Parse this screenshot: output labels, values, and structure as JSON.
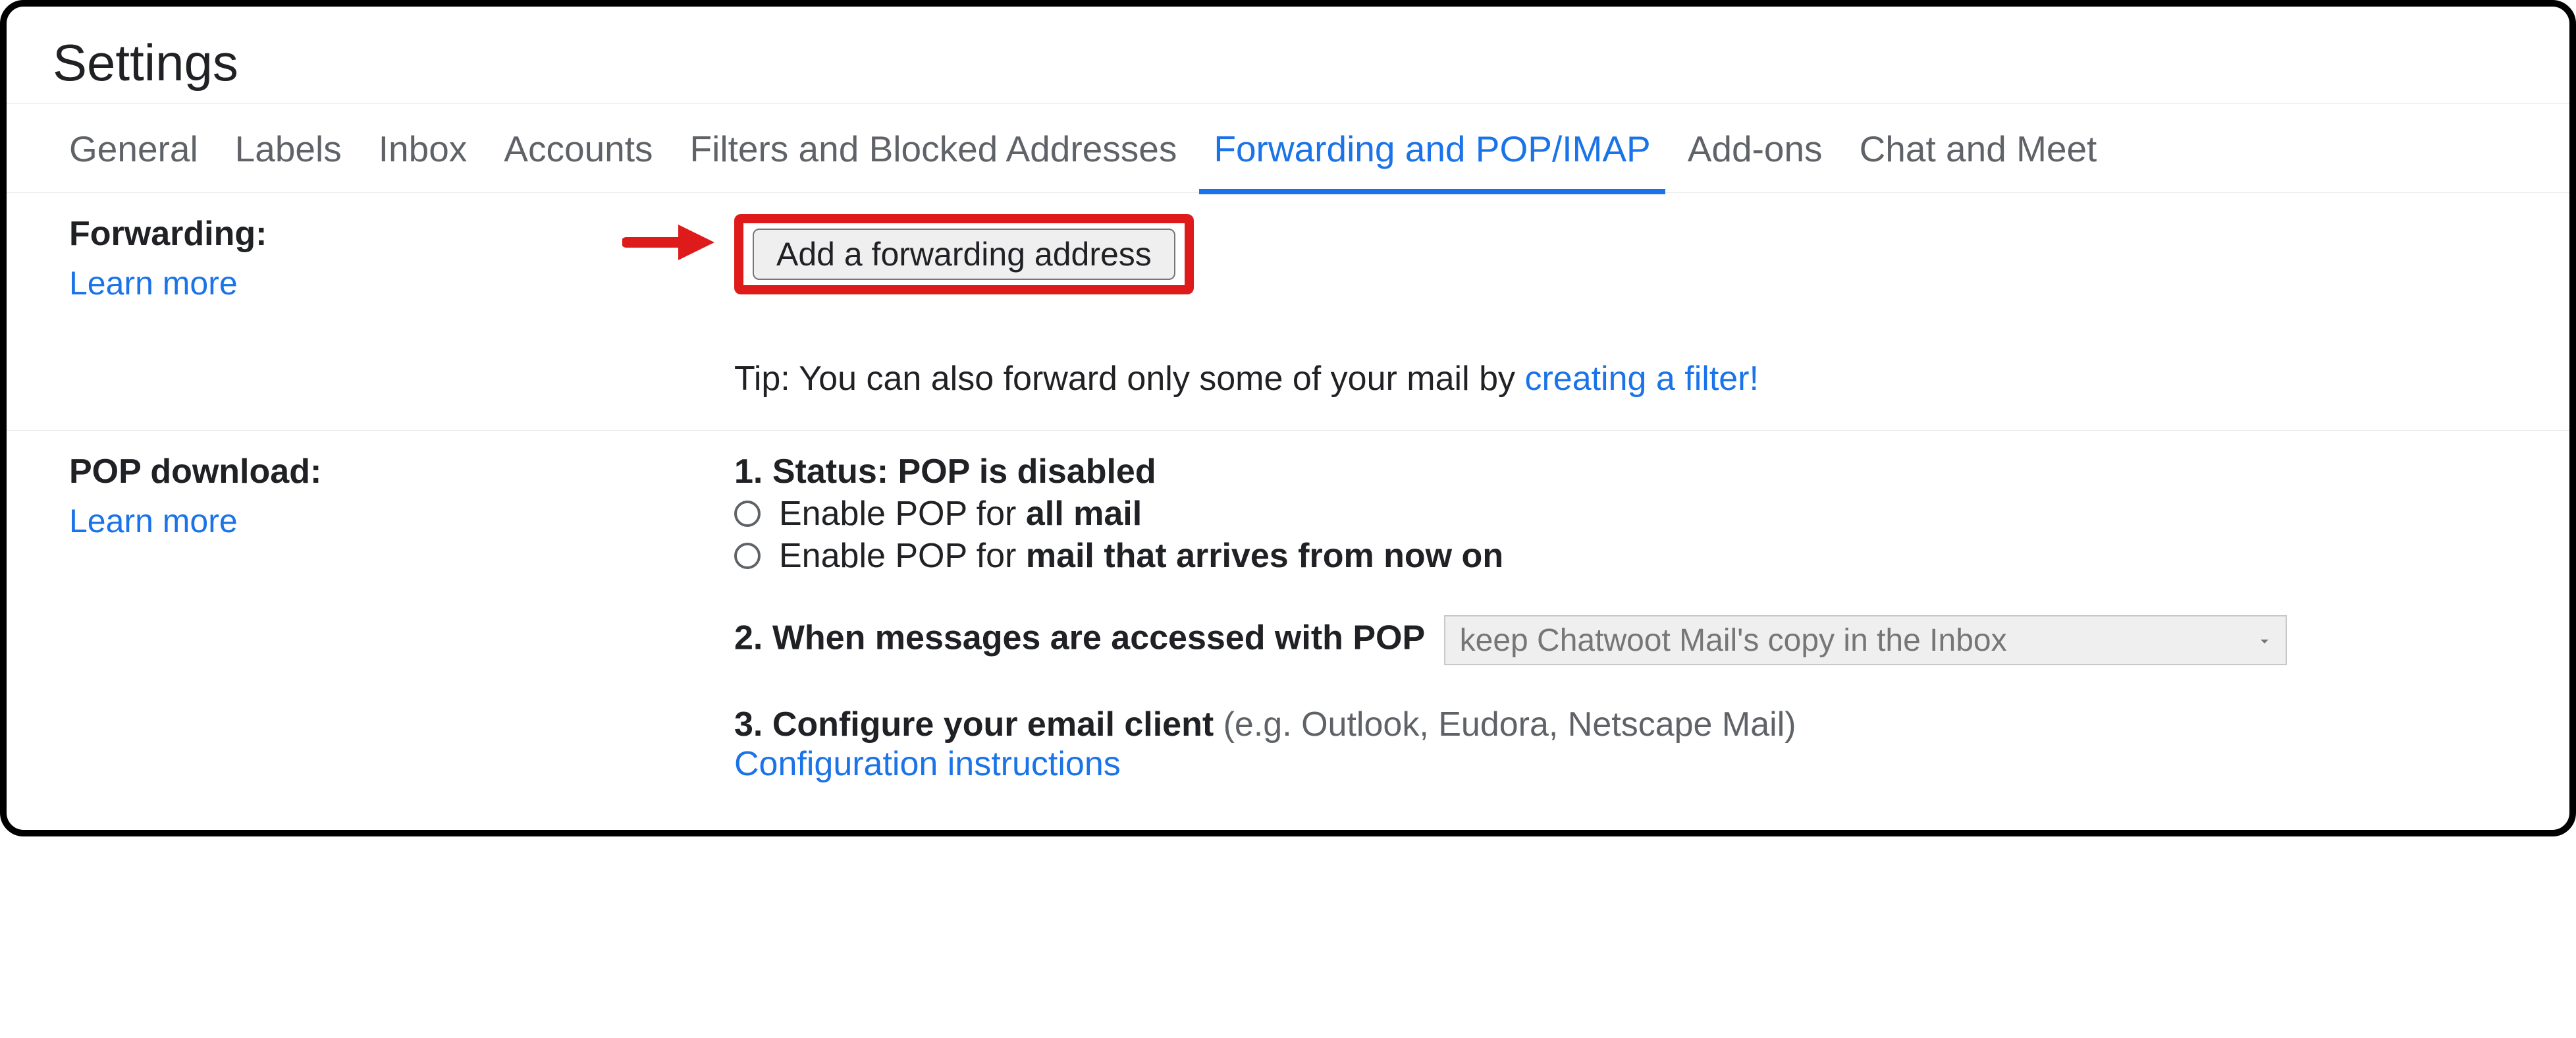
{
  "page_title": "Settings",
  "tabs": [
    {
      "label": "General"
    },
    {
      "label": "Labels"
    },
    {
      "label": "Inbox"
    },
    {
      "label": "Accounts"
    },
    {
      "label": "Filters and Blocked Addresses"
    },
    {
      "label": "Forwarding and POP/IMAP",
      "active": true
    },
    {
      "label": "Add-ons"
    },
    {
      "label": "Chat and Meet"
    }
  ],
  "forwarding": {
    "title": "Forwarding:",
    "learn_more": "Learn more",
    "add_button": "Add a forwarding address",
    "tip_prefix": "Tip: You can also forward only some of your mail by ",
    "tip_link": "creating a filter!"
  },
  "pop": {
    "title": "POP download:",
    "learn_more": "Learn more",
    "status_prefix": "1. Status: ",
    "status_value": "POP is disabled",
    "radio1_prefix": "Enable POP for ",
    "radio1_bold": "all mail",
    "radio2_prefix": "Enable POP for ",
    "radio2_bold": "mail that arrives from now on",
    "when_label": "2. When messages are accessed with POP",
    "select_value": "keep Chatwoot Mail's copy in the Inbox",
    "configure_bold": "3. Configure your email client ",
    "configure_rest": "(e.g. Outlook, Eudora, Netscape Mail)",
    "configure_link": "Configuration instructions"
  }
}
